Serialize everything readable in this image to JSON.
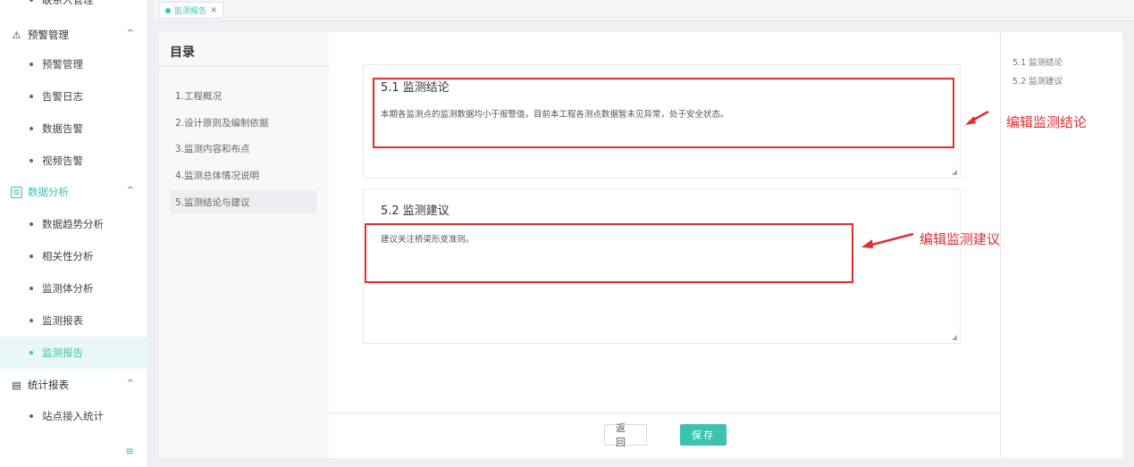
{
  "sidebar": {
    "top_item": "联系人管理",
    "groups": [
      {
        "label": "预警管理",
        "icon": "alarm-icon",
        "items": [
          "预警管理",
          "告警日志",
          "数据告警",
          "视频告警"
        ]
      },
      {
        "label": "数据分析",
        "icon": "chart-icon",
        "items": [
          "数据趋势分析",
          "相关性分析",
          "监测体分析",
          "监测报表",
          "监测报告"
        ]
      },
      {
        "label": "统计报表",
        "icon": "report-icon",
        "items": [
          "站点接入统计"
        ]
      }
    ],
    "caret": "^",
    "collapse_glyph": "≡"
  },
  "tabs": [
    {
      "label": "监测报告",
      "close": "×"
    }
  ],
  "toc": {
    "title": "目录",
    "items": [
      "1.工程概况",
      "2.设计原则及编制依据",
      "3.监测内容和布点",
      "4.监测总体情况说明",
      "5.监测结论与建议"
    ],
    "active_index": 4
  },
  "sections": [
    {
      "title": "5.1 监测结论",
      "text": "本期各监测点的监测数据均小于报警值，目前本工程各测点数据暂未见异常，处于安全状态。"
    },
    {
      "title": "5.2 监测建议",
      "text": "建议关注桥梁形变准则。"
    }
  ],
  "buttons": {
    "back": "返回",
    "save": "保存"
  },
  "right_toc": [
    "5.1 监测结论",
    "5.2 监测建议"
  ],
  "annotations": {
    "conclusion": "编辑监测结论",
    "suggestion": "编辑监测建议"
  },
  "colors": {
    "accent": "#3cc3b0",
    "annotation": "#e02d2d"
  }
}
